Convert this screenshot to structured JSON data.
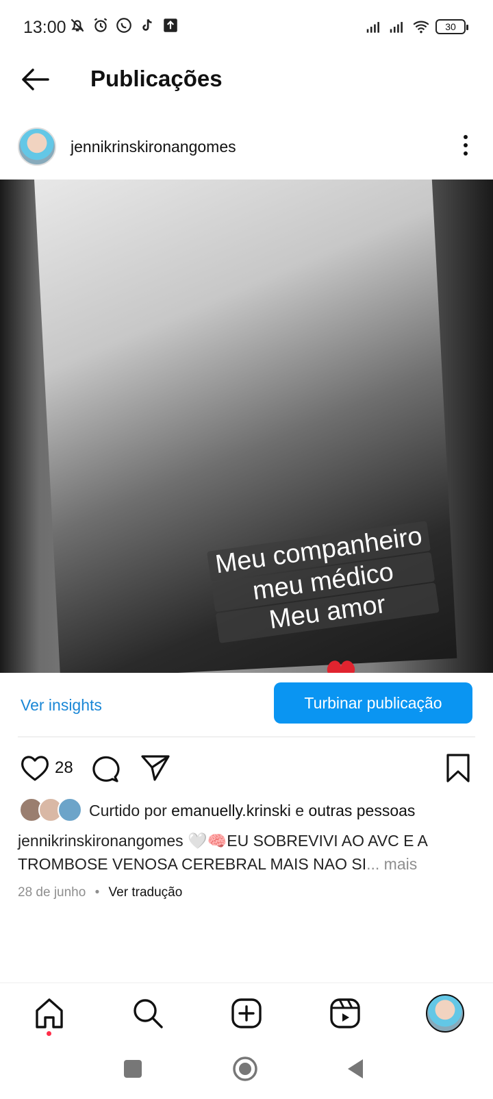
{
  "status_bar": {
    "time": "13:00",
    "battery": "30",
    "left_icons": [
      "bell-off-icon",
      "alarm-icon",
      "whatsapp-icon",
      "tiktok-icon",
      "upload-icon"
    ],
    "right_icons": [
      "signal-icon",
      "signal-icon",
      "wifi-icon"
    ]
  },
  "header": {
    "title": "Publicações"
  },
  "post": {
    "username": "jennikrinskironangomes",
    "image_caption_lines": [
      "Meu companheiro",
      "meu médico",
      "Meu amor"
    ],
    "insights_label": "Ver insights",
    "boost_label": "Turbinar publicação",
    "like_count": "28",
    "liked_by_prefix": "Curtido por",
    "liked_by_user": "emanuelly.krinski",
    "liked_by_connector": "e",
    "liked_by_suffix": "outras pessoas",
    "caption_user": "jennikrinskironangomes",
    "caption_text": "🤍🧠EU SOBREVIVI AO  AVC E A TROMBOSE VENOSA CEREBRAL MAIS NAO SI",
    "caption_more": "... mais",
    "date": "28 de junho",
    "separator": "•",
    "translate_label": "Ver tradução"
  },
  "colors": {
    "accent_blue": "#0a95f2",
    "link_blue": "#1a87d6",
    "notification_dot": "#ff2e49"
  }
}
